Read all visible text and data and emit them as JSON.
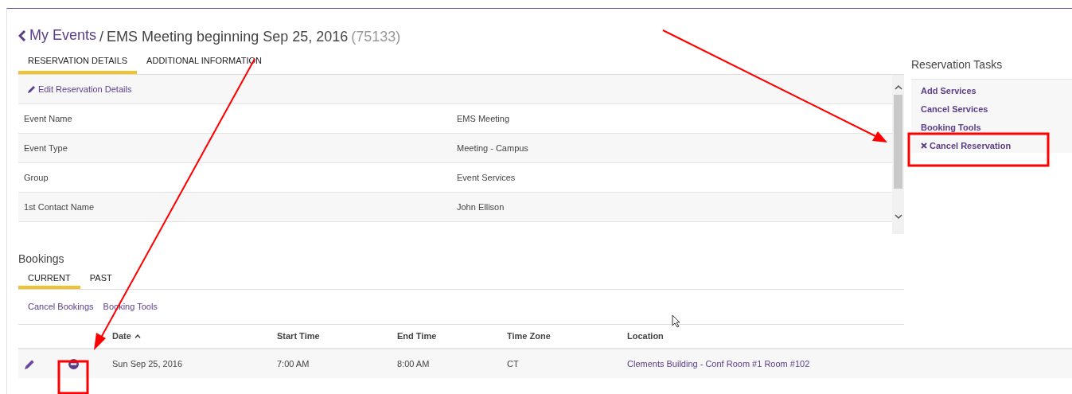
{
  "breadcrumb": {
    "back_link": "My Events",
    "separator": "/",
    "title": "EMS Meeting beginning Sep 25, 2016",
    "id": "(75133)"
  },
  "detail_tabs": [
    {
      "label": "RESERVATION DETAILS",
      "selected": true
    },
    {
      "label": "ADDITIONAL INFORMATION",
      "selected": false
    }
  ],
  "edit_link": "Edit Reservation Details",
  "details": [
    {
      "label": "Event Name",
      "value": "EMS Meeting"
    },
    {
      "label": "Event Type",
      "value": "Meeting - Campus"
    },
    {
      "label": "Group",
      "value": "Event Services"
    },
    {
      "label": "1st Contact Name",
      "value": "John Ellison"
    }
  ],
  "tasks": {
    "title": "Reservation Tasks",
    "items": [
      {
        "label": "Add Services",
        "kind": "link"
      },
      {
        "label": "Cancel Services",
        "kind": "link"
      },
      {
        "label": "Booking Tools",
        "kind": "link"
      },
      {
        "label": "Cancel Reservation",
        "kind": "cancel"
      }
    ]
  },
  "bookings": {
    "title": "Bookings",
    "tabs": [
      {
        "label": "CURRENT",
        "selected": true
      },
      {
        "label": "PAST",
        "selected": false
      }
    ],
    "actions": [
      "Cancel Bookings",
      "Booking Tools"
    ],
    "columns": [
      {
        "label": "Date",
        "sorted": true
      },
      {
        "label": "Start Time",
        "sorted": false
      },
      {
        "label": "End Time",
        "sorted": false
      },
      {
        "label": "Time Zone",
        "sorted": false
      },
      {
        "label": "Location",
        "sorted": false
      }
    ],
    "rows": [
      {
        "date": "Sun Sep 25, 2016",
        "start_time": "7:00 AM",
        "end_time": "8:00 AM",
        "time_zone": "CT",
        "location": "Clements Building - Conf Room #1 Room #102"
      }
    ]
  }
}
